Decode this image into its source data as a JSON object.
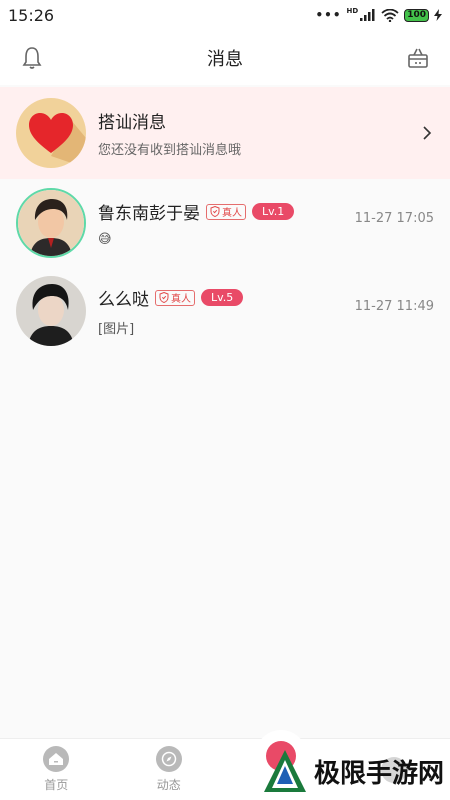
{
  "status_bar": {
    "time": "15:26",
    "network": "HD",
    "battery": "100"
  },
  "nav": {
    "title": "消息",
    "left_icon": "bell-icon",
    "right_icon": "shop-basket-icon"
  },
  "pickup_card": {
    "title": "搭讪消息",
    "subtitle": "您还没有收到搭讪消息哦",
    "icon": "heart-icon",
    "accent": "#e5262b"
  },
  "conversations": [
    {
      "name": "鲁东南彭于晏",
      "real_badge": "真人",
      "level": "Lv.1",
      "preview": "😅",
      "time": "11-27 17:05",
      "online": true
    },
    {
      "name": "么么哒",
      "real_badge": "真人",
      "level": "Lv.5",
      "preview": "[图片]",
      "time": "11-27 11:49",
      "online": false
    }
  ],
  "tabbar": {
    "tabs": [
      {
        "label": "首页",
        "icon": "home-icon"
      },
      {
        "label": "动态",
        "icon": "compass-icon"
      }
    ]
  },
  "watermark": {
    "text": "极限手游网"
  },
  "colors": {
    "accent": "#e94a67",
    "card_bg": "#fff0f0"
  }
}
